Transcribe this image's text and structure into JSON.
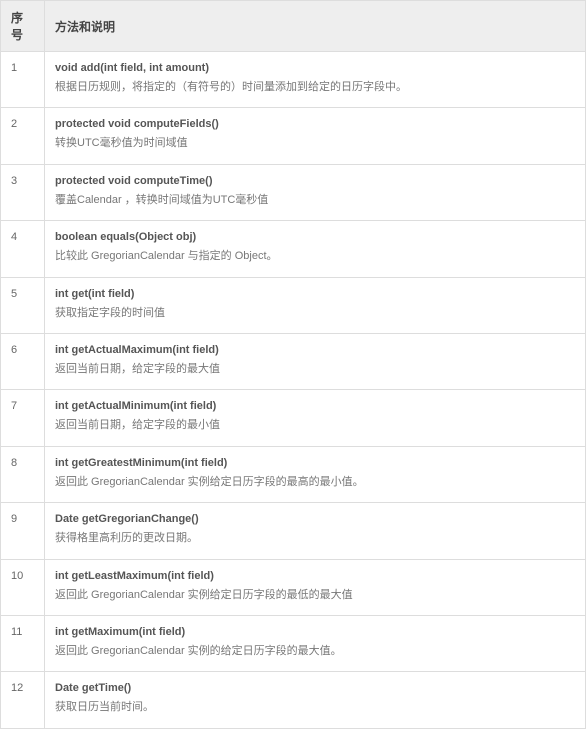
{
  "headers": {
    "index": "序号",
    "method": "方法和说明"
  },
  "rows": [
    {
      "n": "1",
      "sig": "void add(int field, int amount)",
      "desc": "根据日历规则，将指定的（有符号的）时间量添加到给定的日历字段中。"
    },
    {
      "n": "2",
      "sig": "protected void computeFields()",
      "desc": "转换UTC毫秒值为时间域值"
    },
    {
      "n": "3",
      "sig": "protected void computeTime()",
      "desc": "覆盖Calendar ，转换时间域值为UTC毫秒值"
    },
    {
      "n": "4",
      "sig": "boolean equals(Object obj)",
      "desc": "比较此 GregorianCalendar 与指定的 Object。"
    },
    {
      "n": "5",
      "sig": "int get(int field)",
      "desc": "获取指定字段的时间值"
    },
    {
      "n": "6",
      "sig": "int getActualMaximum(int field)",
      "desc": "返回当前日期，给定字段的最大值"
    },
    {
      "n": "7",
      "sig": "int getActualMinimum(int field)",
      "desc": "返回当前日期，给定字段的最小值"
    },
    {
      "n": "8",
      "sig": "int getGreatestMinimum(int field)",
      "desc": "返回此 GregorianCalendar 实例给定日历字段的最高的最小值。"
    },
    {
      "n": "9",
      "sig": "Date getGregorianChange()",
      "desc": "获得格里高利历的更改日期。"
    },
    {
      "n": "10",
      "sig": "int getLeastMaximum(int field)",
      "desc": "返回此 GregorianCalendar 实例给定日历字段的最低的最大值"
    },
    {
      "n": "11",
      "sig": "int getMaximum(int field)",
      "desc": "返回此 GregorianCalendar 实例的给定日历字段的最大值。"
    },
    {
      "n": "12",
      "sig": "Date getTime()",
      "desc": "获取日历当前时间。"
    }
  ]
}
